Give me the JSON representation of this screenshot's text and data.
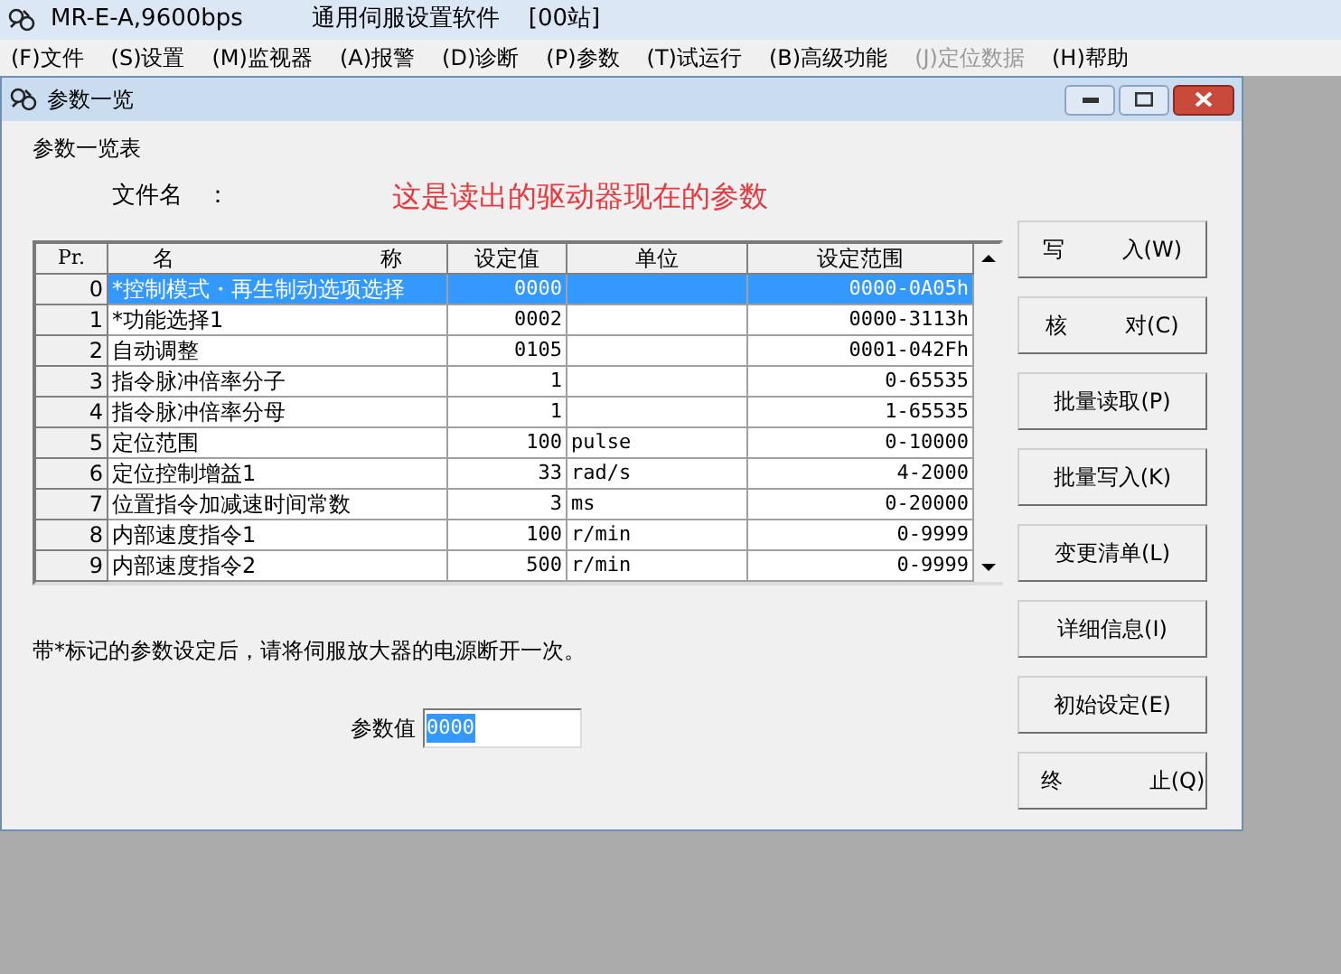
{
  "app": {
    "title": "MR-E-A,9600bps",
    "subtitle": "通用伺服设置软件",
    "station": "[00站]"
  },
  "menu": [
    {
      "label": "(F)文件",
      "disabled": false
    },
    {
      "label": "(S)设置",
      "disabled": false
    },
    {
      "label": "(M)监视器",
      "disabled": false
    },
    {
      "label": "(A)报警",
      "disabled": false
    },
    {
      "label": "(D)诊断",
      "disabled": false
    },
    {
      "label": "(P)参数",
      "disabled": false
    },
    {
      "label": "(T)试运行",
      "disabled": false
    },
    {
      "label": "(B)高级功能",
      "disabled": false
    },
    {
      "label": "(J)定位数据",
      "disabled": true
    },
    {
      "label": "(H)帮助",
      "disabled": false
    }
  ],
  "window": {
    "title": "参数一览"
  },
  "group_label": "参数一览表",
  "file_name_label": "文件名　：",
  "annotation": "这是读出的驱动器现在的参数",
  "table": {
    "columns": [
      "Pr.",
      "名 称",
      "设定值",
      "单位",
      "设定范围"
    ],
    "rows": [
      {
        "cells": [
          "0",
          "*控制模式・再生制动选项选择",
          "0000",
          "",
          "0000-0A05h"
        ],
        "selected": true
      },
      {
        "cells": [
          "1",
          "*功能选择1",
          "0002",
          "",
          "0000-3113h"
        ],
        "selected": false
      },
      {
        "cells": [
          "2",
          "自动调整",
          "0105",
          "",
          "0001-042Fh"
        ],
        "selected": false
      },
      {
        "cells": [
          "3",
          "指令脉冲倍率分子",
          "1",
          "",
          "0-65535"
        ],
        "selected": false
      },
      {
        "cells": [
          "4",
          "指令脉冲倍率分母",
          "1",
          "",
          "1-65535"
        ],
        "selected": false
      },
      {
        "cells": [
          "5",
          "定位范围",
          "100",
          "pulse",
          "0-10000"
        ],
        "selected": false
      },
      {
        "cells": [
          "6",
          "定位控制增益1",
          "33",
          "rad/s",
          "4-2000"
        ],
        "selected": false
      },
      {
        "cells": [
          "7",
          "位置指令加减速时间常数",
          "3",
          "ms",
          "0-20000"
        ],
        "selected": false
      },
      {
        "cells": [
          "8",
          "内部速度指令1",
          "100",
          "r/min",
          "0-9999"
        ],
        "selected": false
      },
      {
        "cells": [
          "9",
          "内部速度指令2",
          "500",
          "r/min",
          "0-9999"
        ],
        "selected": false
      }
    ]
  },
  "note": "带*标记的参数设定后，请将伺服放大器的电源断开一次。",
  "value_field": {
    "label": "参数值",
    "value": "0000"
  },
  "buttons": [
    {
      "label": "写 入(W)",
      "kind": "spread"
    },
    {
      "label": "核 对(C)",
      "kind": "spread"
    },
    {
      "label": "批量读取(P)",
      "kind": "normal"
    },
    {
      "label": "批量写入(K)",
      "kind": "normal"
    },
    {
      "label": "变更清单(L)",
      "kind": "normal"
    },
    {
      "label": "详细信息(I)",
      "kind": "normal"
    },
    {
      "label": "初始设定(E)",
      "kind": "normal"
    },
    {
      "label": "终 止(Q)",
      "kind": "wide"
    }
  ]
}
